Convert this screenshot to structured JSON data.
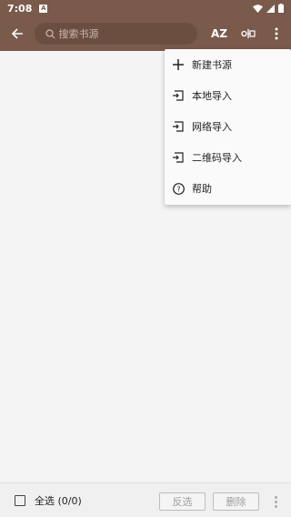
{
  "status_bar": {
    "time": "7:08",
    "notification_letter": "A"
  },
  "toolbar": {
    "search_placeholder": "搜索书源",
    "sort_label": "AZ"
  },
  "menu": {
    "items": [
      {
        "label": "新建书源",
        "icon": "plus-icon"
      },
      {
        "label": "本地导入",
        "icon": "import-icon"
      },
      {
        "label": "网络导入",
        "icon": "import-icon"
      },
      {
        "label": "二维码导入",
        "icon": "import-icon"
      },
      {
        "label": "帮助",
        "icon": "help-icon"
      }
    ]
  },
  "bottom_bar": {
    "select_all_label": "全选 (0/0)",
    "invert_label": "反选",
    "delete_label": "删除"
  },
  "colors": {
    "primary": "#7a5a4a",
    "background": "#f4f4f4"
  }
}
